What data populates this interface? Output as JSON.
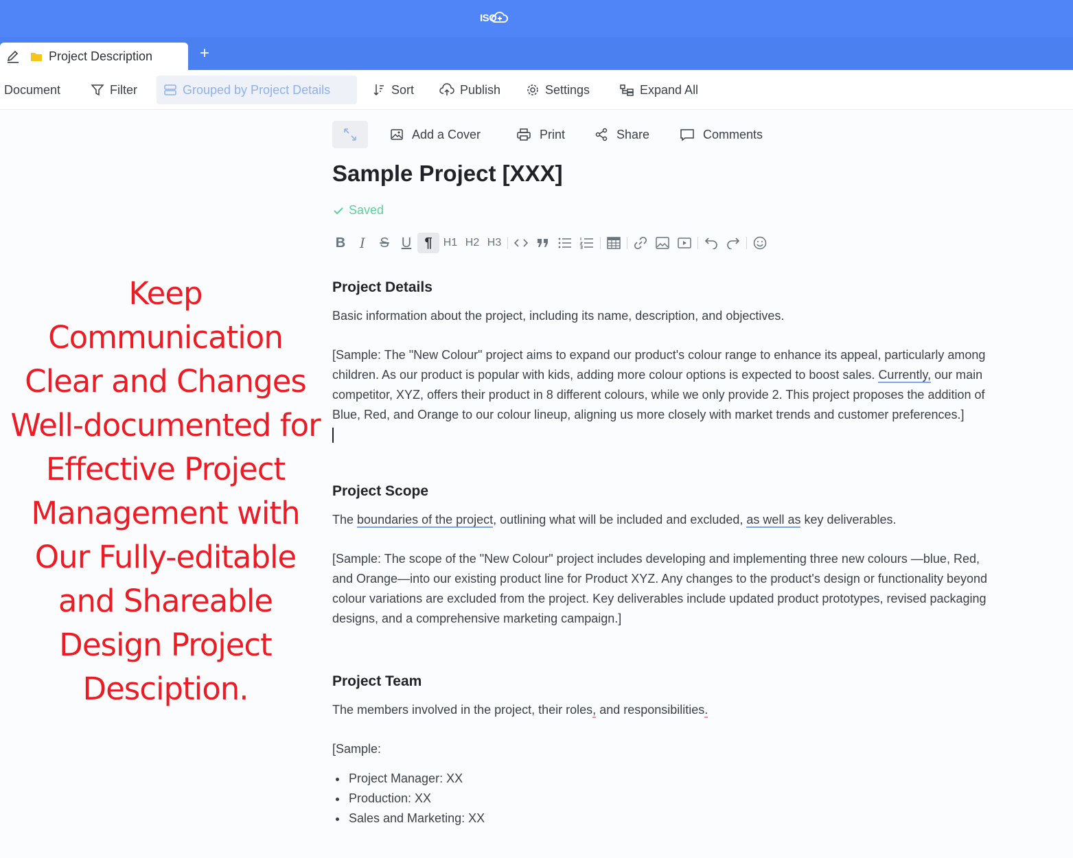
{
  "app": {
    "logo_text": "ISO"
  },
  "tab": {
    "label": "Project Description",
    "add_label": "+"
  },
  "toolbar": {
    "document": "Document",
    "filter": "Filter",
    "grouped": "Grouped by Project Details",
    "sort": "Sort",
    "publish": "Publish",
    "settings": "Settings",
    "expand_all": "Expand All"
  },
  "promo": {
    "text": "Keep Communication Clear and Changes Well-documented for Effective Project Management with Our Fully-editable and Shareable Design Project Desciption."
  },
  "doc_actions": {
    "add_cover": "Add a Cover",
    "print": "Print",
    "share": "Share",
    "comments": "Comments"
  },
  "document": {
    "title": "Sample Project [XXX]",
    "status": "Saved"
  },
  "format_toolbar": {
    "bold": "B",
    "italic": "I",
    "strike": "S",
    "underline": "U",
    "paragraph": "¶",
    "h1": "H1",
    "h2": "H2",
    "h3": "H3"
  },
  "sections": {
    "details": {
      "heading": "Project Details",
      "lead": "Basic information about the project, including its name, description, and objectives.",
      "sample_a": "[Sample: The \"New Colour\" project aims to expand our product's colour range to enhance its appeal, particularly among children. As our product is popular with kids, adding more colour options is expected to boost sales. ",
      "sample_link": "Currently,",
      "sample_b": " our main competitor, XYZ, offers their product in 8 different colours, while we only provide 2. This project proposes the addition of Blue, Red, and Orange to our colour lineup, aligning us more closely with market trends and customer preferences.]"
    },
    "scope": {
      "heading": "Project Scope",
      "lead_a": "The ",
      "lead_u1": "boundaries of the project",
      "lead_b": ", outlining what will be included and excluded, ",
      "lead_u2": "as well as",
      "lead_c": " key deliverables.",
      "sample": "[Sample: The scope of the \"New Colour\" project includes developing and implementing three new colours —blue, Red, and Orange—into our existing product line for Product XYZ. Any changes to the product's design or functionality beyond colour variations are excluded from the project. Key deliverables include updated product prototypes, revised packaging designs, and a comprehensive marketing campaign.]"
    },
    "team": {
      "heading": "Project Team",
      "lead_a": "The members involved in the project, their roles",
      "lead_u1": ",",
      "lead_b": " and responsibilities",
      "lead_u2": ".",
      "sample": "[Sample:",
      "members": [
        "Project Manager: XX",
        "Production: XX",
        "Sales and Marketing: XX"
      ]
    }
  },
  "colors": {
    "topbar": "#4f85f7",
    "tabbar": "#4a80f0",
    "saved": "#5fcf9a",
    "promo": "#ec1c24",
    "grouped_text": "#8fb0ee"
  }
}
